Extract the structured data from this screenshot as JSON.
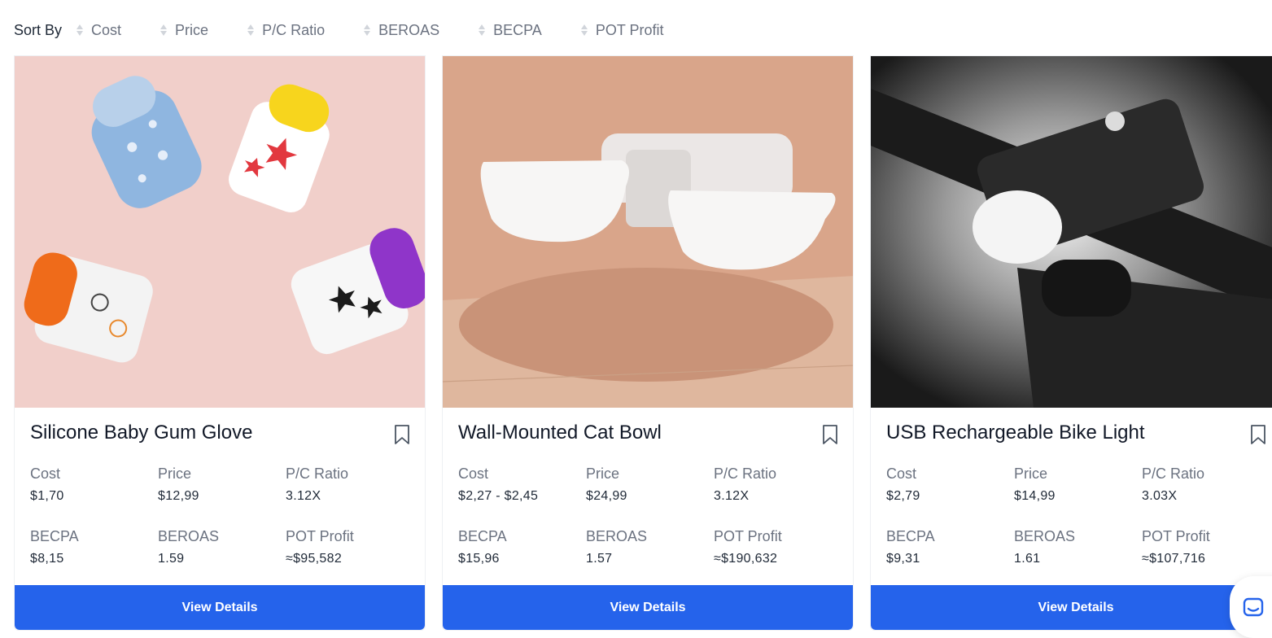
{
  "sort": {
    "label": "Sort By",
    "options": [
      "Cost",
      "Price",
      "P/C Ratio",
      "BEROAS",
      "BECPA",
      "POT Profit"
    ]
  },
  "metric_labels": {
    "cost": "Cost",
    "price": "Price",
    "pc_ratio": "P/C Ratio",
    "becpa": "BECPA",
    "beroas": "BEROAS",
    "pot_profit": "POT Profit"
  },
  "products": [
    {
      "title": "Silicone Baby Gum Glove",
      "cost": "$1,70",
      "price": "$12,99",
      "pc_ratio": "3.12X",
      "becpa": "$8,15",
      "beroas": "1.59",
      "pot_profit": "≈$95,582",
      "cta": "View Details"
    },
    {
      "title": "Wall-Mounted Cat Bowl",
      "cost": "$2,27 - $2,45",
      "price": "$24,99",
      "pc_ratio": "3.12X",
      "becpa": "$15,96",
      "beroas": "1.57",
      "pot_profit": "≈$190,632",
      "cta": "View Details"
    },
    {
      "title": "USB Rechargeable Bike Light",
      "cost": "$2,79",
      "price": "$14,99",
      "pc_ratio": "3.03X",
      "becpa": "$9,31",
      "beroas": "1.61",
      "pot_profit": "≈$107,716",
      "cta": "View Details"
    }
  ],
  "colors": {
    "accent": "#2563eb",
    "muted": "#6b7280"
  }
}
